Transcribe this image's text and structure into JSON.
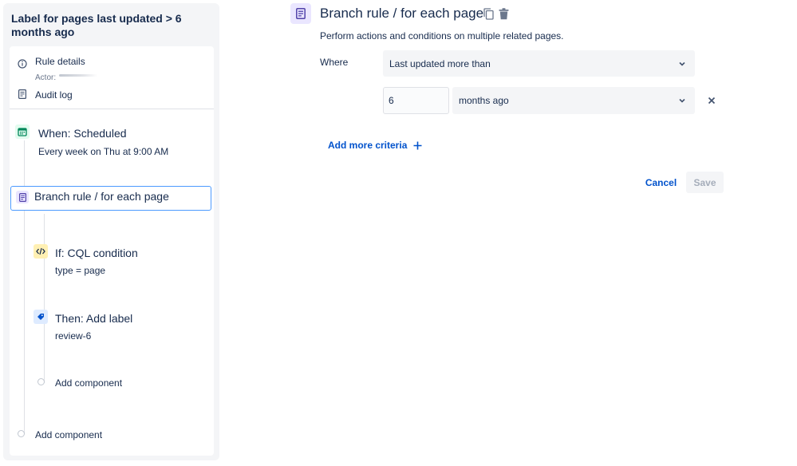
{
  "rule": {
    "title": "Label for pages last updated > 6 months ago"
  },
  "sidebar": {
    "rule_details_label": "Rule details",
    "actor_label": "Actor:",
    "audit_log_label": "Audit log",
    "trigger": {
      "title": "When: Scheduled",
      "subtitle": "Every week on Thu at 9:00 AM",
      "icon": "calendar-icon",
      "color": "#36b37e"
    },
    "branch": {
      "title": "Branch rule / for each page",
      "icon": "page-icon",
      "color": "#6554c0"
    },
    "condition": {
      "title": "If: CQL condition",
      "subtitle": "type = page",
      "icon": "code-icon",
      "color": "#ffe380"
    },
    "action": {
      "title": "Then: Add label",
      "subtitle": "review-6",
      "icon": "tag-icon",
      "color": "#0052cc"
    },
    "add_component_inner": "Add component",
    "add_component_outer": "Add component"
  },
  "editor": {
    "title": "Branch rule / for each page",
    "description": "Perform actions and conditions on multiple related pages.",
    "where_label": "Where",
    "where_select": "Last updated more than",
    "amount_value": "6",
    "unit_select": "months ago",
    "add_criteria_label": "Add more criteria",
    "cancel_label": "Cancel",
    "save_label": "Save"
  },
  "colors": {
    "accent": "#0052cc",
    "selection_border": "#4c9aff",
    "branch_icon_bg": "#eae6ff"
  }
}
